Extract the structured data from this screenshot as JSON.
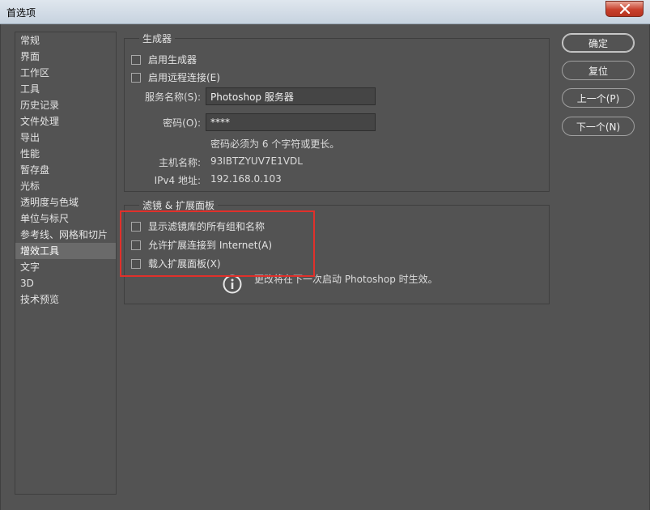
{
  "window": {
    "title": "首选项",
    "close_icon": "close-icon"
  },
  "sidebar": {
    "items": [
      {
        "label": "常规"
      },
      {
        "label": "界面"
      },
      {
        "label": "工作区"
      },
      {
        "label": "工具"
      },
      {
        "label": "历史记录"
      },
      {
        "label": "文件处理"
      },
      {
        "label": "导出"
      },
      {
        "label": "性能"
      },
      {
        "label": "暂存盘"
      },
      {
        "label": "光标"
      },
      {
        "label": "透明度与色域"
      },
      {
        "label": "单位与标尺"
      },
      {
        "label": "参考线、网格和切片"
      },
      {
        "label": "增效工具",
        "active": true
      },
      {
        "label": "文字"
      },
      {
        "label": "3D"
      },
      {
        "label": "技术预览"
      }
    ]
  },
  "generator": {
    "title": "生成器",
    "enable_generator": "启用生成器",
    "enable_remote": "启用远程连接(E)",
    "service_name_label": "服务名称(S):",
    "service_name_value": "Photoshop 服务器",
    "password_label": "密码(O):",
    "password_value": "****",
    "password_hint": "密码必须为 6 个字符或更长。",
    "hostname_label": "主机名称:",
    "hostname_value": "93IBTZYUV7E1VDL",
    "ipv4_label": "IPv4 地址:",
    "ipv4_value": "192.168.0.103"
  },
  "filters": {
    "title": "滤镜 & 扩展面板",
    "show_all": "显示滤镜库的所有组和名称",
    "allow_internet": "允许扩展连接到 Internet(A)",
    "load_panels": "载入扩展面板(X)",
    "restart_note": "更改将在下一次启动 Photoshop 时生效。",
    "info_icon": "info-icon"
  },
  "buttons": {
    "ok": "确定",
    "reset": "复位",
    "prev": "上一个(P)",
    "next": "下一个(N)"
  },
  "colors": {
    "background": "#535353",
    "highlight_box": "#e0302b"
  }
}
